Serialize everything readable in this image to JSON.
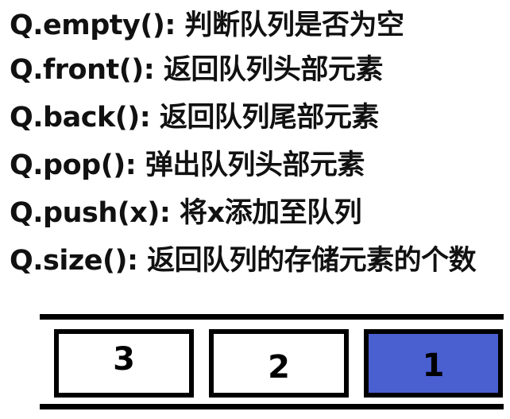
{
  "methods": [
    "Q.empty(): 判断队列是否为空",
    "Q.front(): 返回队列头部元素",
    "Q.back(): 返回队列尾部元素",
    "Q.pop(): 弹出队列头部元素",
    "Q.push(x): 将x添加至队列",
    "Q.size(): 返回队列的存储元素的个数"
  ],
  "queue": {
    "cells": [
      {
        "label": "3",
        "fill": "#ffffff"
      },
      {
        "label": "2",
        "fill": "#ffffff"
      },
      {
        "label": "1",
        "fill": "#4a5fd0"
      }
    ]
  }
}
